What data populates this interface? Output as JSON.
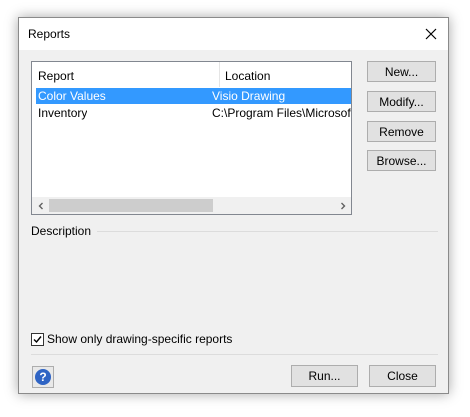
{
  "dialog": {
    "title": "Reports"
  },
  "list": {
    "columns": [
      "Report",
      "Location"
    ],
    "rows": [
      {
        "report": "Color Values",
        "location": "Visio Drawing",
        "selected": true
      },
      {
        "report": "Inventory",
        "location": "C:\\Program Files\\Microsoft",
        "selected": false
      }
    ]
  },
  "buttons": {
    "new": "New...",
    "modify": "Modify...",
    "remove": "Remove",
    "browse": "Browse...",
    "run": "Run...",
    "close": "Close"
  },
  "description": {
    "label": "Description"
  },
  "filter": {
    "label": "Show only drawing-specific reports",
    "checked": true
  },
  "icons": {
    "close": "close-icon",
    "help": "help-icon",
    "scroll_left": "chevron-left-icon",
    "scroll_right": "chevron-right-icon",
    "check": "checkmark-icon"
  },
  "colors": {
    "selection": "#3399ff",
    "help_icon": "#2f64c4"
  }
}
